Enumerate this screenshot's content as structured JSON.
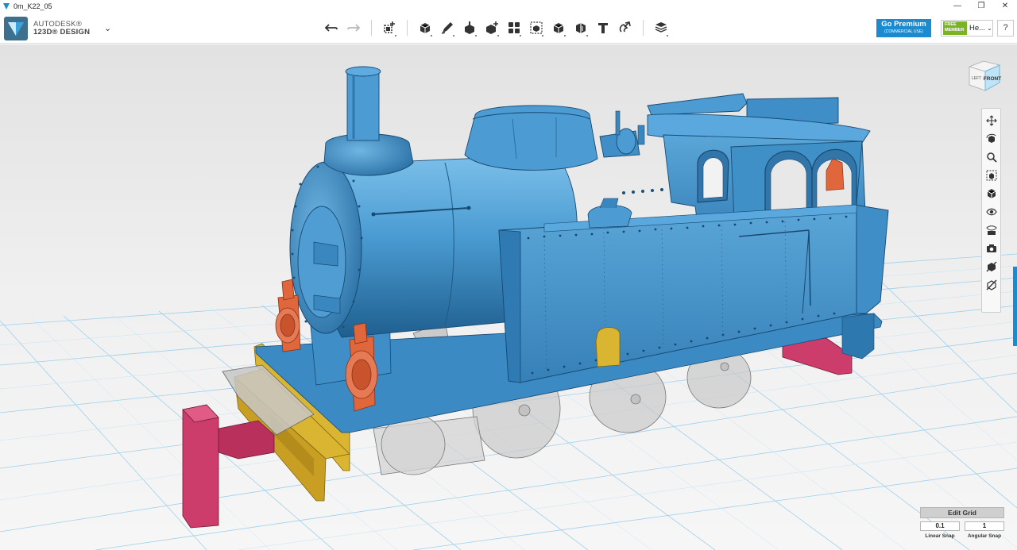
{
  "window": {
    "title": "0m_K22_05",
    "controls": {
      "minimize": "—",
      "maximize": "❐",
      "close": "✕"
    }
  },
  "brand": {
    "line1": "AUTODESK®",
    "line2": "123D® DESIGN",
    "menu_chevron": "⌄"
  },
  "toolbar": {
    "tools": [
      {
        "name": "undo-button",
        "icon": "undo-icon"
      },
      {
        "name": "redo-button",
        "icon": "redo-icon"
      },
      {
        "name": "transform-button",
        "icon": "transform-icon"
      },
      {
        "name": "primitives-button",
        "icon": "primitives-icon"
      },
      {
        "name": "sketch-button",
        "icon": "sketch-icon"
      },
      {
        "name": "construct-button",
        "icon": "construct-icon"
      },
      {
        "name": "modify-button",
        "icon": "modify-icon"
      },
      {
        "name": "pattern-button",
        "icon": "pattern-icon"
      },
      {
        "name": "grouping-button",
        "icon": "grouping-icon"
      },
      {
        "name": "combine-button",
        "icon": "combine-icon"
      },
      {
        "name": "measure-button",
        "icon": "measure-icon"
      },
      {
        "name": "text-button",
        "icon": "text-icon"
      },
      {
        "name": "snap-button",
        "icon": "snap-icon"
      },
      {
        "name": "material-button",
        "icon": "material-icon"
      }
    ]
  },
  "account": {
    "premium_main": "Go Premium",
    "premium_sub": "(COMMERCIAL USE)",
    "badge_line1": "FREE",
    "badge_line2": "MEMBER",
    "user_name": "He...",
    "help": "?"
  },
  "viewcube": {
    "front_label": "FRONT",
    "left_label": "LEFT"
  },
  "navbar": {
    "items": [
      "pan-icon",
      "orbit-icon",
      "zoom-icon",
      "fit-icon",
      "view-icon",
      "visibility-icon",
      "materials-icon",
      "screenshot-icon",
      "outline-icon",
      "hidden-icon"
    ]
  },
  "grid_panel": {
    "button": "Edit Grid",
    "linear_value": "0.1",
    "angular_value": "1",
    "linear_label": "Linear Snap",
    "angular_label": "Angular Snap"
  },
  "colors": {
    "brand_blue": "#1a8ad1",
    "member_green": "#7bb323",
    "model_blue": "#4a9bd2",
    "model_orange": "#e0663c",
    "model_yellow": "#d9b531",
    "model_pink": "#cc3d6b",
    "grid_blue": "#8ec8e6"
  }
}
